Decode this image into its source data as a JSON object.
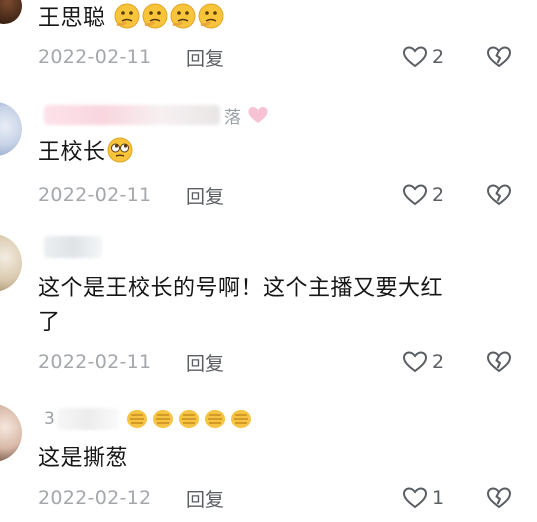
{
  "comments": [
    {
      "username": "王思聪",
      "text": "",
      "date": "2022-02-11",
      "reply_label": "回复",
      "likes": "2",
      "emoji_count": 4
    },
    {
      "username_suffix": "落",
      "text": "王校长",
      "date": "2022-02-11",
      "reply_label": "回复",
      "likes": "2"
    },
    {
      "text_line1": "这个是王校长的号啊！这个主播又要大红",
      "text_line2": "了",
      "date": "2022-02-11",
      "reply_label": "回复",
      "likes": "2"
    },
    {
      "username_prefix": "3",
      "text": "这是撕葱",
      "date": "2022-02-12",
      "reply_label": "回复",
      "likes": "1"
    }
  ],
  "icons": {
    "like": "heart-outline-icon",
    "dislike": "broken-heart-icon",
    "emoji_thinking": "thinking-face-emoji",
    "emoji_rolling": "rolling-eyes-emoji",
    "emoji_clap": "clapping-hands-emoji"
  },
  "colors": {
    "date": "#a4a7ab",
    "action": "#5a5e63",
    "text": "#161616"
  }
}
